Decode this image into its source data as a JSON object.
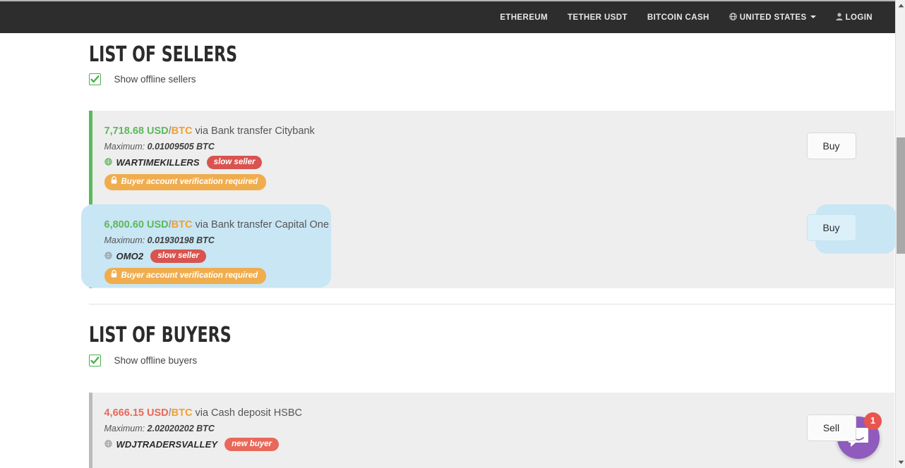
{
  "nav": {
    "items": [
      {
        "label": "ETHEREUM",
        "icon": ""
      },
      {
        "label": "TETHER USDT",
        "icon": ""
      },
      {
        "label": "BITCOIN CASH",
        "icon": ""
      },
      {
        "label": "UNITED STATES",
        "icon": "globe-icon",
        "caret": true
      },
      {
        "label": "LOGIN",
        "icon": "user-icon"
      }
    ]
  },
  "sellers": {
    "title": "LIST OF SELLERS",
    "toggle_label": "Show offline sellers",
    "toggle_checked": true,
    "rows": [
      {
        "price": "7,718.68",
        "currency_from": "USD",
        "slash": "/",
        "currency_to": "BTC",
        "via": "via Bank transfer Citybank",
        "max_label": "Maximum:",
        "max_value": "0.01009505 BTC",
        "trader": "WARTIMEKILLERS",
        "status": "online",
        "badge": "slow seller",
        "verify": "Buyer account verification required",
        "action_label": "Buy",
        "highlighted": false
      },
      {
        "price": "6,800.60",
        "currency_from": "USD",
        "slash": "/",
        "currency_to": "BTC",
        "via": "via Bank transfer Capital One",
        "max_label": "Maximum:",
        "max_value": "0.01930198 BTC",
        "trader": "OMO2",
        "status": "offline",
        "badge": "slow seller",
        "verify": "Buyer account verification required",
        "action_label": "Buy",
        "highlighted": true
      }
    ]
  },
  "buyers": {
    "title": "LIST OF BUYERS",
    "toggle_label": "Show offline buyers",
    "toggle_checked": true,
    "rows": [
      {
        "price": "4,666.15",
        "currency_from": "USD",
        "slash": "/",
        "currency_to": "BTC",
        "via": "via Cash deposit HSBC",
        "max_label": "Maximum:",
        "max_value": "2.02020202 BTC",
        "trader": "WDJTRADERSVALLEY",
        "status": "offline",
        "badge": "new buyer",
        "action_label": "Sell",
        "highlighted": false
      }
    ]
  },
  "intercom": {
    "badge_count": "1",
    "icon": "chat-bubble-icon"
  },
  "colors": {
    "nav_bg": "#2d2d2d",
    "accent_green": "#5cb85c",
    "accent_orange": "#f0a030",
    "price_red": "#e8685a",
    "badge_red": "#d9534f",
    "verify_orange": "#f0ad4e",
    "highlight_blue": "#c9e6f4",
    "intercom_purple": "#8f5bbd"
  }
}
